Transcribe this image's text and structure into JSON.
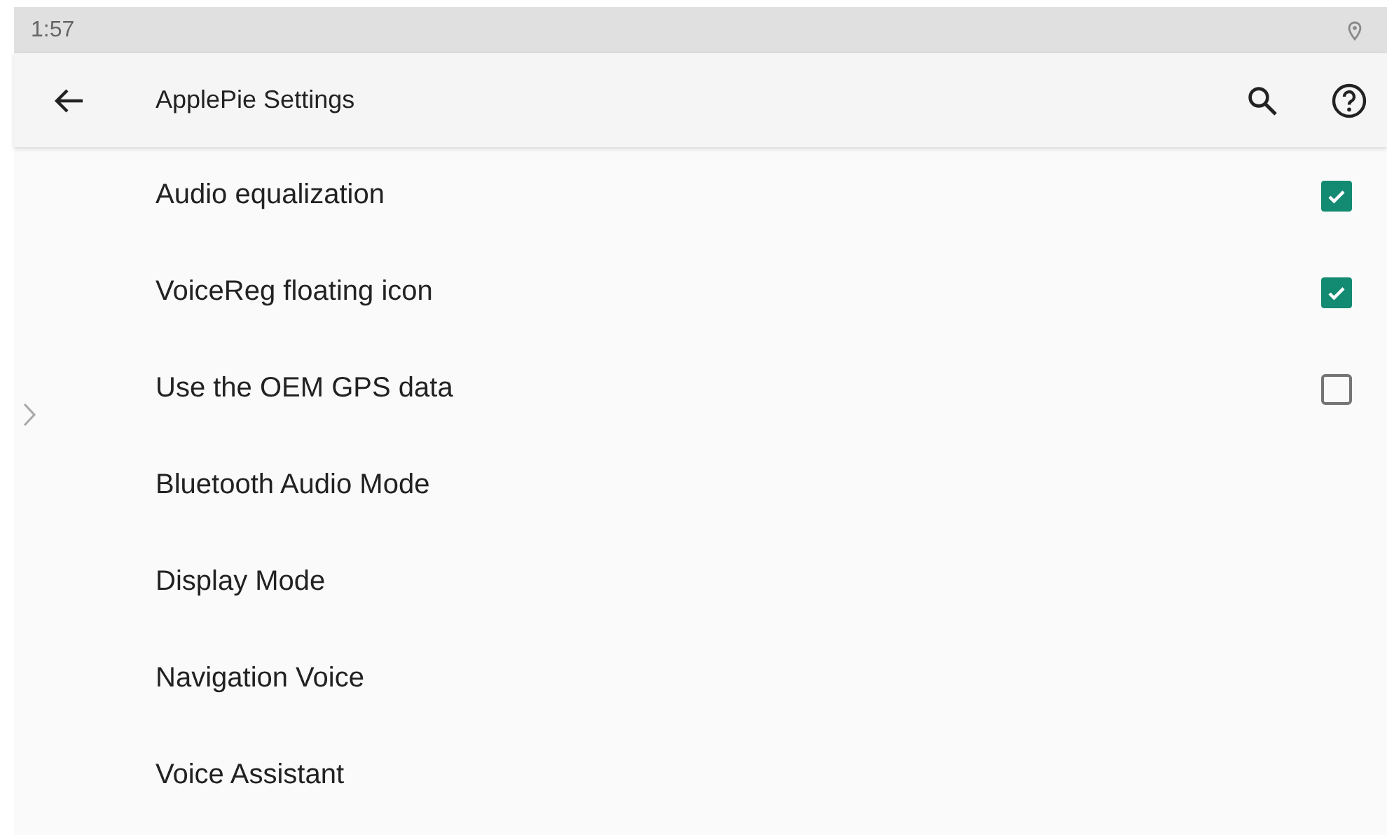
{
  "status_bar": {
    "time": "1:57"
  },
  "toolbar": {
    "title": "ApplePie Settings"
  },
  "settings": [
    {
      "label": "Audio equalization",
      "kind": "checkbox",
      "checked": true
    },
    {
      "label": "VoiceReg floating icon",
      "kind": "checkbox",
      "checked": true
    },
    {
      "label": "Use the OEM GPS data",
      "kind": "checkbox",
      "checked": false
    },
    {
      "label": "Bluetooth Audio Mode",
      "kind": "plain"
    },
    {
      "label": "Display Mode",
      "kind": "plain"
    },
    {
      "label": "Navigation Voice",
      "kind": "plain"
    },
    {
      "label": "Voice Assistant",
      "kind": "plain"
    }
  ]
}
